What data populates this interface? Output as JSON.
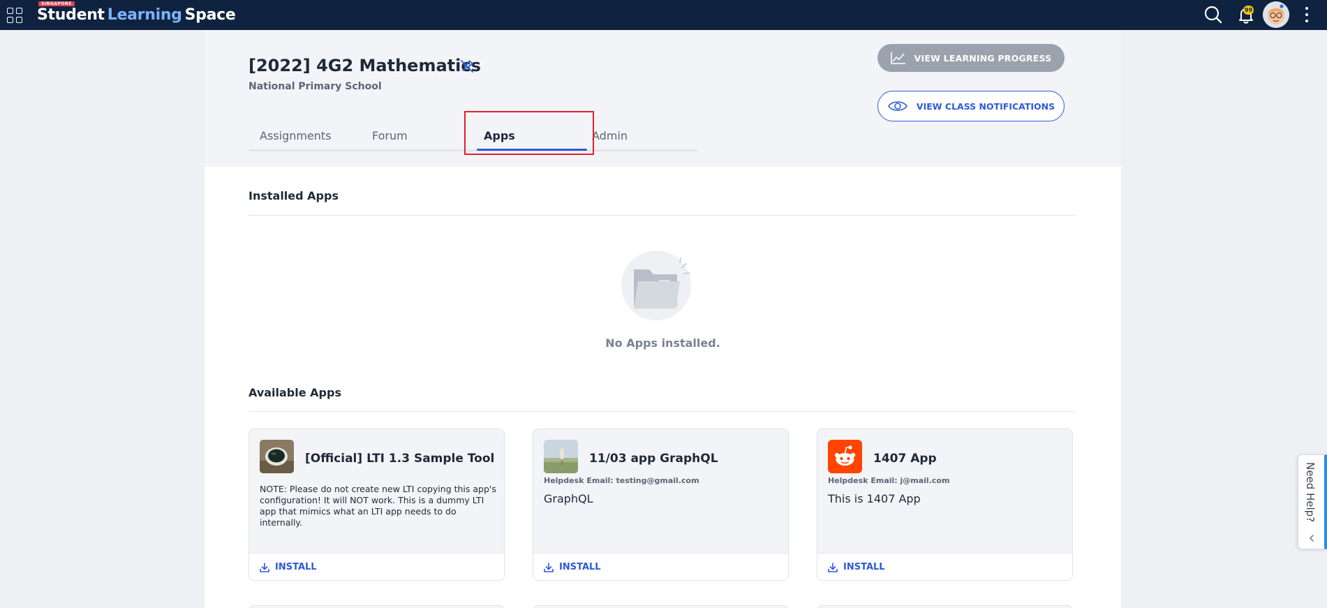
{
  "topbar": {
    "brand_badge": "SINGAPORE",
    "brand_part1": "Student",
    "brand_part2": "Learning",
    "brand_part3": "Space",
    "notification_count": "99"
  },
  "header": {
    "class_title": "[2022] 4G2 Mathematics",
    "school_name": "National Primary School",
    "tabs": [
      {
        "label": "Assignments",
        "active": false
      },
      {
        "label": "Forum",
        "active": false
      },
      {
        "label": "Apps",
        "active": true
      },
      {
        "label": "Admin",
        "active": false
      }
    ],
    "btn_progress": "VIEW LEARNING PROGRESS",
    "btn_notifications": "VIEW CLASS NOTIFICATIONS"
  },
  "installed": {
    "title": "Installed Apps",
    "empty_text": "No Apps installed."
  },
  "available": {
    "title": "Available Apps",
    "install_label": "INSTALL",
    "apps": [
      {
        "name": "[Official] LTI 1.3 Sample Tool",
        "description": "NOTE: Please do not create new LTI copying this app's configuration! It will NOT work. This is a dummy LTI app that mimics what an LTI app needs to do internally."
      },
      {
        "name": "11/03 app GraphQL",
        "helpdesk": "Helpdesk Email: testing@gmail.com",
        "text": "GraphQL"
      },
      {
        "name": "1407 App",
        "helpdesk": "Helpdesk Email: j@mail.com",
        "text": "This is 1407 App"
      }
    ]
  },
  "help": {
    "label": "Need Help?"
  },
  "colors": {
    "topbar": "#0f2340",
    "accent": "#2c5bd8",
    "highlight": "#e0202a",
    "reddit_orange": "#ff4500"
  }
}
